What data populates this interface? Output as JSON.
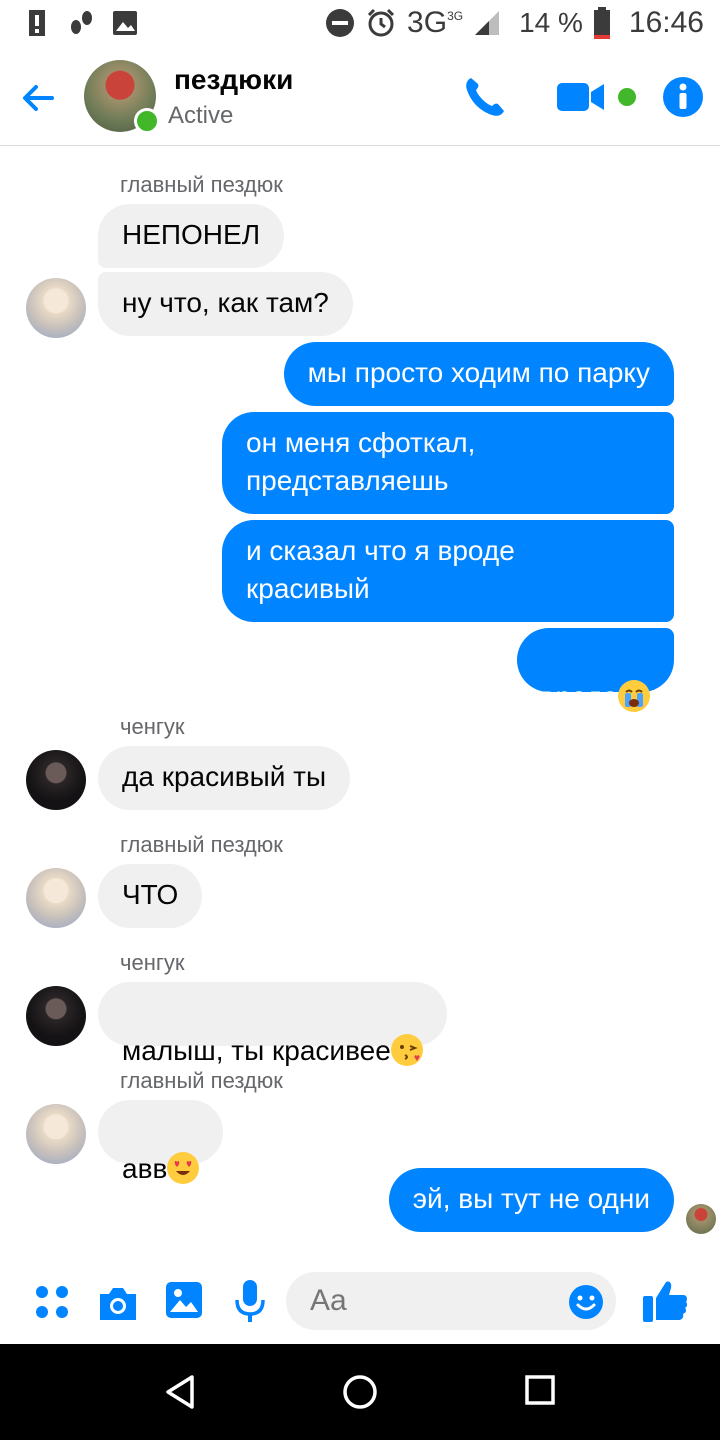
{
  "status_bar": {
    "network": "3G",
    "network_sub": "3G",
    "battery_percent": "14 %",
    "time": "16:46",
    "icons": [
      "alert-icon",
      "steps-icon",
      "image-icon",
      "dnd-icon",
      "alarm-icon",
      "signal-icon",
      "battery-icon"
    ]
  },
  "header": {
    "title": "пездюки",
    "subtitle": "Active",
    "icons": [
      "back-arrow-icon",
      "phone-icon",
      "video-icon",
      "info-icon"
    ],
    "accent": "#0084ff",
    "online_color": "#42b72a"
  },
  "messages": [
    {
      "type": "sender",
      "text": "главный пездюк"
    },
    {
      "type": "in",
      "text": "НЕПОНЕЛ"
    },
    {
      "type": "in",
      "text": "ну что, как там?",
      "avatar": "light"
    },
    {
      "type": "out",
      "text": "мы просто ходим по парку"
    },
    {
      "type": "out",
      "text": "он меня сфоткал,\nпредставляешь"
    },
    {
      "type": "out",
      "text": "и сказал что я вроде\nкрасивый"
    },
    {
      "type": "out",
      "text": "вроде",
      "emoji": "crying-face"
    },
    {
      "type": "sender",
      "text": "ченгук"
    },
    {
      "type": "in",
      "text": "да красивый ты",
      "avatar": "dark"
    },
    {
      "type": "sender",
      "text": "главный пездюк"
    },
    {
      "type": "in",
      "text": "ЧТО",
      "avatar": "light"
    },
    {
      "type": "sender",
      "text": "ченгук"
    },
    {
      "type": "in",
      "text": "малыш, ты красивее",
      "emoji": "kiss-face",
      "avatar": "dark"
    },
    {
      "type": "sender",
      "text": "главный пездюк"
    },
    {
      "type": "in",
      "text": "авв",
      "emoji": "heart-eyes-face",
      "avatar": "light"
    },
    {
      "type": "out",
      "text": "эй, вы тут не одни"
    }
  ],
  "composer": {
    "placeholder": "Aa",
    "icons": [
      "apps-icon",
      "camera-icon",
      "gallery-icon",
      "mic-icon",
      "emoji-icon",
      "like-icon"
    ]
  },
  "nav_bar": {
    "icons": [
      "back-triangle-icon",
      "home-circle-icon",
      "recents-square-icon"
    ]
  },
  "colors": {
    "outgoing_bubble": "#0084ff",
    "incoming_bubble": "#f0f0f0"
  }
}
